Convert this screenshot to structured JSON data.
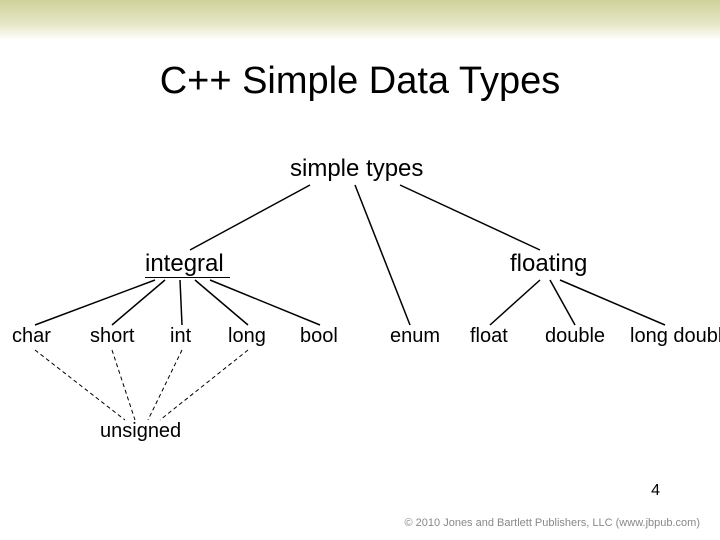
{
  "title": "C++ Simple Data Types",
  "root": "simple types",
  "integral": "integral",
  "floating": "floating",
  "leaves": {
    "char": "char",
    "short": "short",
    "int": "int",
    "long": "long",
    "bool": "bool",
    "enum": "enum",
    "float": "float",
    "double": "double",
    "long_double": "long double"
  },
  "unsigned": "unsigned",
  "footer": {
    "copyright": "© 2010 Jones and Bartlett Publishers, LLC",
    "url": "(www.jbpub.com)"
  },
  "page_number": "4"
}
